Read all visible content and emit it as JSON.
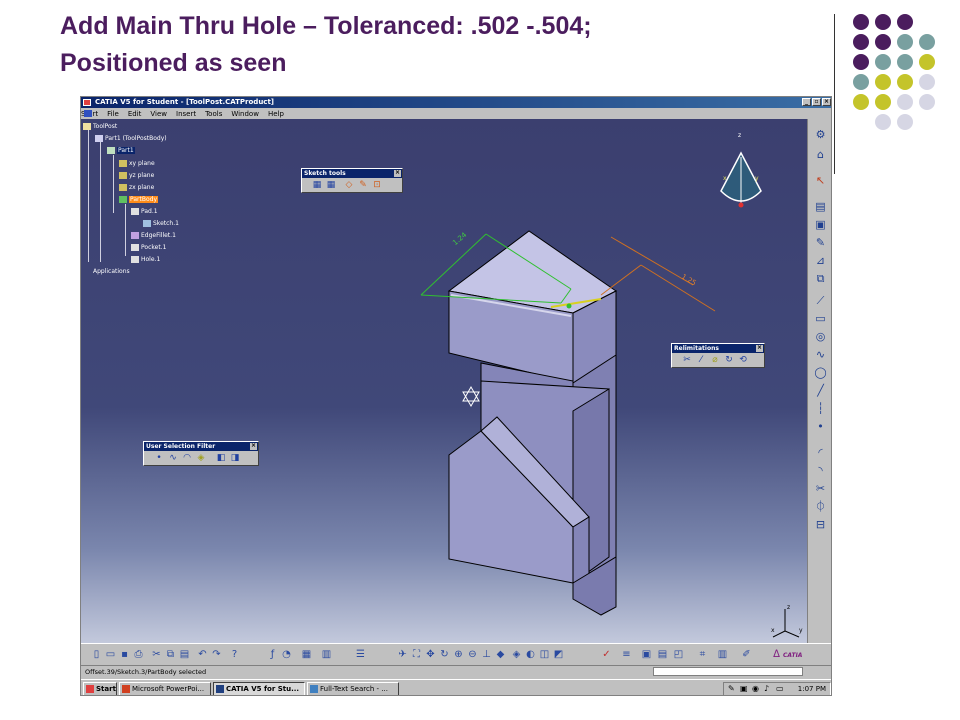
{
  "slide": {
    "title_line1": "Add Main Thru Hole – Toleranced: .502 -.504;",
    "title_line2": "Positioned as seen",
    "dot_colors": [
      "#4b1d5e",
      "#79a0a0",
      "#c4c42a",
      "#d6d6e4"
    ]
  },
  "window": {
    "title": "CATIA V5 for Student - [ToolPost.CATProduct]",
    "menu": [
      "Start",
      "File",
      "Edit",
      "View",
      "Insert",
      "Tools",
      "Window",
      "Help"
    ]
  },
  "spec_tree": {
    "root": "ToolPost",
    "part_body": "Part1 (ToolPostBody)",
    "part": "Part1",
    "planes": [
      "xy plane",
      "yz plane",
      "zx plane"
    ],
    "partbody": "PartBody",
    "features": [
      "Pad.1",
      "Sketch.1",
      "EdgeFillet.1",
      "Pocket.1",
      "Hole.1"
    ],
    "applications": "Applications"
  },
  "toolbars": {
    "sketch_tools": "Sketch tools",
    "relimitations": "Relimitations",
    "user_selection_filter": "User Selection Filter"
  },
  "dimensions": {
    "left": "1.24",
    "right": "1.25"
  },
  "axis_labels": {
    "x": "x",
    "y": "y",
    "z": "z"
  },
  "compass_labels": {
    "x": "x",
    "y": "y",
    "z": "z"
  },
  "status": {
    "message": "Offset.39/Sketch.3/PartBody selected"
  },
  "taskbar": {
    "start": "Start",
    "items": [
      "Microsoft PowerPoi...",
      "CATIA V5 for Stu...",
      "Full-Text Search - ..."
    ],
    "clock": "1:07 PM"
  },
  "brand": "CATIA",
  "colors": {
    "title": "#4b1d5e",
    "viewport_top": "#3b3f6f",
    "part_face_top": "#c4c4e6",
    "part_face_side": "#9898c4",
    "dim_green": "#30c030",
    "dim_orange": "#d07020",
    "highlight": "#ff8c1a"
  }
}
